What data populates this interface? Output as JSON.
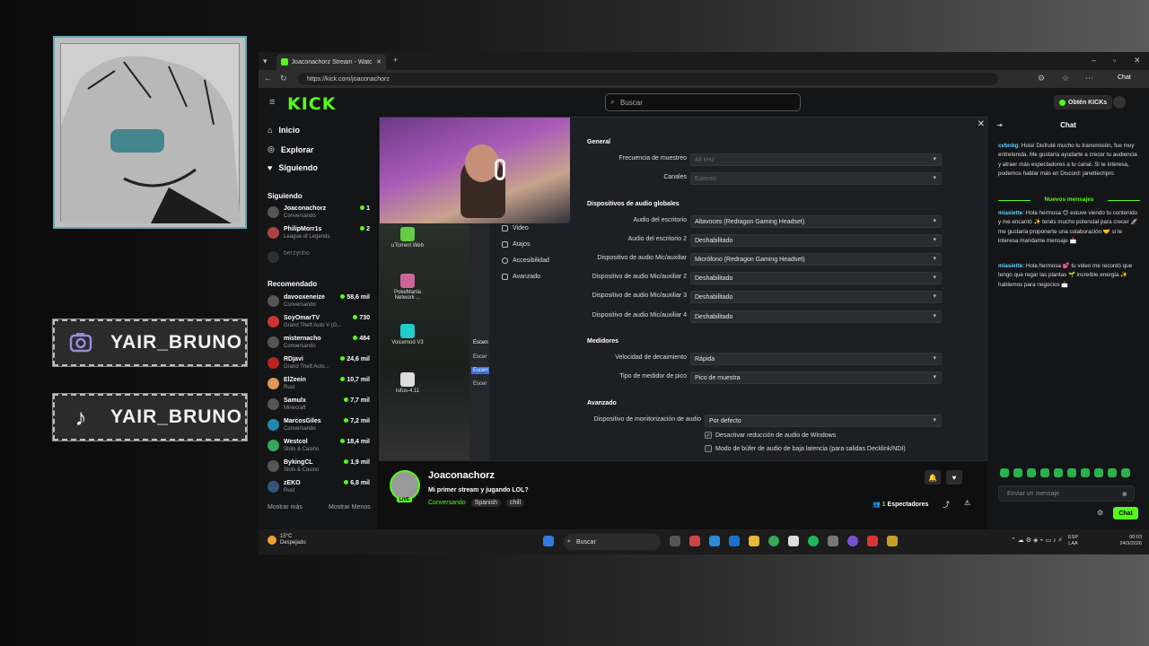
{
  "overlay": {
    "instagram_handle": "YAIR_BRUNO",
    "tiktok_handle": "YAIR_BRUNO"
  },
  "browser": {
    "tab_title": "Joaconachorz Stream - Watch Live",
    "url": "https://kick.com/joaconachorz",
    "chat_button": "Chat"
  },
  "kick": {
    "logo": "KICK",
    "search_placeholder": "Buscar",
    "get_kicks": "Obtén KICKs",
    "nav": [
      {
        "label": "Inicio",
        "icon": "home-icon"
      },
      {
        "label": "Explorar",
        "icon": "compass-icon"
      },
      {
        "label": "Siguiendo",
        "icon": "heart-icon"
      }
    ],
    "following_title": "Siguiendo",
    "following": [
      {
        "name": "Joaconachorz",
        "category": "Conversando",
        "viewers": "1"
      },
      {
        "name": "PhilipMorr1s",
        "category": "League of Legends",
        "viewers": "2"
      },
      {
        "name": "berzynho",
        "category": "",
        "viewers": ""
      }
    ],
    "recommended_title": "Recomendado",
    "recommended": [
      {
        "name": "davooxeneize",
        "category": "Conversando",
        "viewers": "58,6 mil"
      },
      {
        "name": "SoyOmarTV",
        "category": "Grand Theft Auto V (G...",
        "viewers": "730"
      },
      {
        "name": "misternacho",
        "category": "Conversando",
        "viewers": "484"
      },
      {
        "name": "RDjavi",
        "category": "Grand Theft Auto...",
        "viewers": "24,6 mil"
      },
      {
        "name": "ElZeein",
        "category": "Rust",
        "viewers": "10,7 mil"
      },
      {
        "name": "Samulx",
        "category": "Minecraft",
        "viewers": "7,7 mil"
      },
      {
        "name": "MarcosGiles",
        "category": "Conversando",
        "viewers": "7,2 mil"
      },
      {
        "name": "Westcol",
        "category": "Slots & Casino",
        "viewers": "18,4 mil"
      },
      {
        "name": "BykingCL",
        "category": "Slots & Casino",
        "viewers": "1,9 mil"
      },
      {
        "name": "zEKO",
        "category": "Rust",
        "viewers": "6,8 mil"
      }
    ],
    "show_more": "Mostrar más",
    "show_less": "Mostrar Menos"
  },
  "desktop_icons": [
    "uTorrent Web",
    "PokeMania Network ...",
    "Voicemod V3",
    "rufus-4.11"
  ],
  "obs_menu": [
    {
      "label": "Video"
    },
    {
      "label": "Atajos"
    },
    {
      "label": "Accesibilidad"
    },
    {
      "label": "Avanzado"
    }
  ],
  "obs_scene_labels": [
    "Escen",
    "Escer",
    "Escen",
    "Escer"
  ],
  "settings": {
    "general_title": "General",
    "sample_rate_label": "Frecuencia de muestreo",
    "sample_rate_value": "48 kHz",
    "channels_label": "Canales",
    "channels_value": "Estéreo",
    "global_devices_title": "Dispositivos de audio globales",
    "devices": [
      {
        "label": "Audio del escritorio",
        "value": "Altavoces (Redragon Gaming Headset)"
      },
      {
        "label": "Audio del escritorio 2",
        "value": "Deshabilitado"
      },
      {
        "label": "Dispositivo de audio Mic/auxiliar",
        "value": "Micrófono (Redragon Gaming Headset)"
      },
      {
        "label": "Dispositivo de audio Mic/auxiliar 2",
        "value": "Deshabilitado"
      },
      {
        "label": "Dispositivo de audio Mic/auxiliar 3",
        "value": "Deshabilitado"
      },
      {
        "label": "Dispositivo de audio Mic/auxiliar 4",
        "value": "Deshabilitado"
      }
    ],
    "meters_title": "Medidores",
    "decay_label": "Velocidad de decaimiento",
    "decay_value": "Rápida",
    "peak_label": "Tipo de medidor de pico",
    "peak_value": "Pico de muestra",
    "advanced_title": "Avanzado",
    "monitor_label": "Dispositivo de monitorización de audio",
    "monitor_value": "Por defecto",
    "check1": "Desactivar reducción de audio de Windows",
    "check2": "Modo de búfer de audio de baja latencia (para salidas Decklink/NDI)"
  },
  "stream": {
    "streamer": "Joaconachorz",
    "title": "Mi primer stream y jugando LOL?",
    "category": "Conversando",
    "tags": [
      "Spanish",
      "chill"
    ],
    "viewers_count": "1",
    "viewers_label": "Espectadores",
    "live_badge": "LIVE"
  },
  "chat": {
    "title": "Chat",
    "first_message": {
      "user": "cvbnbg",
      "text": ": Hola! Disfruté mucho tu transmisión, fue muy entretenida. Me gustaría ayudarte a crecer tu audiencia y atraer más espectadores a tu canal. Si te interesa, podemos hablar más en Discord: janettechpro"
    },
    "new_messages": "Nuevos mensajes",
    "messages": [
      {
        "user": "miasiette",
        "text": ": Hola hermosa 😊 estuve viendo tu contenido y me encantó ✨ tenés mucho potencial para crecer 🚀 me gustaría proponerte una colaboración 🤝 si te interesa mandame mensaje 📩"
      },
      {
        "user": "miasiette",
        "text": ": Hola hermosa 💕 tu video me recordó que tengo que regar las plantas 🌱 increíble energía ✨ hablemos para negocios 📩"
      }
    ],
    "input_placeholder": "Enviar un mensaje",
    "send_button": "Chat"
  },
  "taskbar": {
    "temperature": "15°C",
    "weather": "Despejado",
    "search": "Buscar",
    "lang_top": "ESP",
    "lang_bottom": "LAA",
    "time": "00:03",
    "date": "24/3/2026"
  }
}
